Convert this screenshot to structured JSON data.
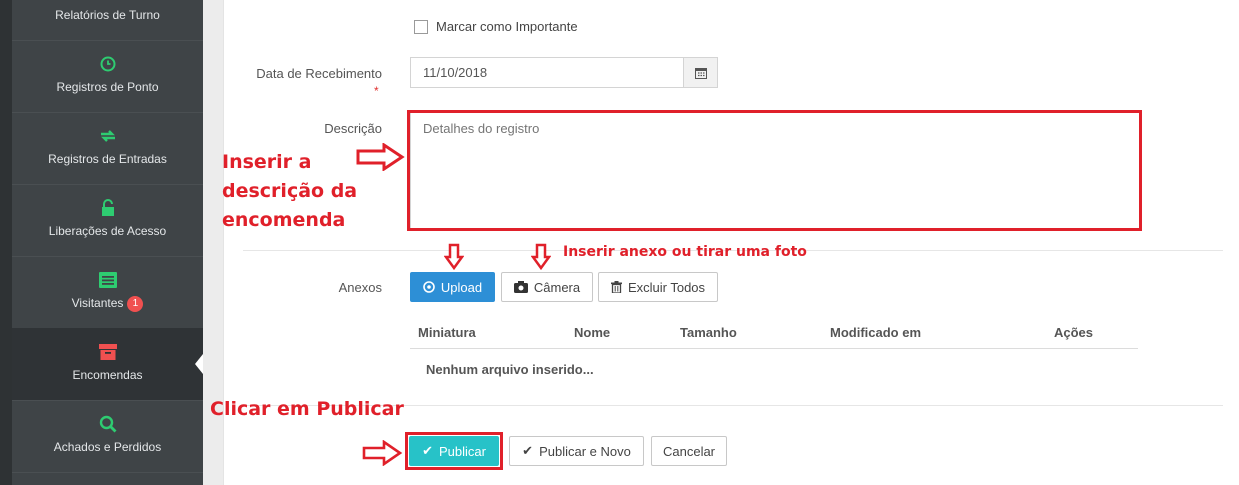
{
  "sidebar": {
    "items": [
      {
        "label": "Relatórios de Turno",
        "icon": "report-icon"
      },
      {
        "label": "Registros de Ponto",
        "icon": "clock-icon"
      },
      {
        "label": "Registros de Entradas",
        "icon": "exchange-icon"
      },
      {
        "label": "Liberações de Acesso",
        "icon": "unlock-icon"
      },
      {
        "label": "Visitantes",
        "icon": "list-icon",
        "badge": "1"
      },
      {
        "label": "Encomendas",
        "icon": "archive-box-icon",
        "active": true
      },
      {
        "label": "Achados e Perdidos",
        "icon": "search-icon"
      }
    ]
  },
  "form": {
    "important_label": "Marcar como Importante",
    "date_label": "Data de Recebimento",
    "required_mark": "*",
    "date_value": "11/10/2018",
    "description_label": "Descrição",
    "description_placeholder": "Detalhes do registro",
    "attachments_label": "Anexos",
    "upload_label": "Upload",
    "camera_label": "Câmera",
    "delete_all_label": "Excluir Todos",
    "table": {
      "headers": [
        "Miniatura",
        "Nome",
        "Tamanho",
        "Modificado em",
        "Ações"
      ],
      "empty_text": "Nenhum arquivo inserido..."
    },
    "publish_label": "Publicar",
    "publish_new_label": "Publicar e Novo",
    "cancel_label": "Cancelar"
  },
  "annotations": {
    "description_line1": "Inserir a",
    "description_line2": "descrição da",
    "description_line3": "encomenda",
    "attach": "Inserir anexo ou tirar uma foto",
    "publish": "Clicar em Publicar"
  },
  "colors": {
    "sidebar_bg": "#3f4447",
    "icon_green": "#2ecc71",
    "icon_red": "#f05050",
    "btn_blue": "#2d8fd6",
    "btn_teal": "#27c2c8",
    "annotation_red": "#e0202a"
  }
}
